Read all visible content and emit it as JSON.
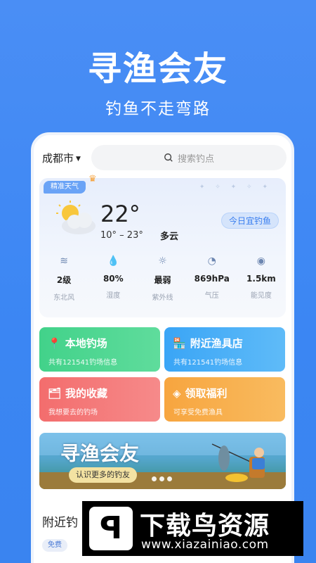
{
  "hero": {
    "title": "寻渔会友",
    "subtitle": "钓鱼不走弯路"
  },
  "header": {
    "city": "成都市",
    "search_placeholder": "搜索钓点"
  },
  "weather": {
    "tag": "精准天气",
    "temperature": "22°",
    "range": "10° – 23°",
    "condition": "多云",
    "fishing_badge": "今日宜钓鱼",
    "stats": [
      {
        "icon": "wind-icon",
        "value": "2级",
        "label": "东北风"
      },
      {
        "icon": "humidity-icon",
        "value": "80%",
        "label": "湿度"
      },
      {
        "icon": "uv-icon",
        "value": "最弱",
        "label": "紫外线"
      },
      {
        "icon": "pressure-icon",
        "value": "869hPa",
        "label": "气压"
      },
      {
        "icon": "visibility-icon",
        "value": "1.5km",
        "label": "能见度"
      }
    ]
  },
  "tiles": [
    {
      "title": "本地钓场",
      "subtitle": "共有121541钓场信息",
      "icon": "location-pin-icon"
    },
    {
      "title": "附近渔具店",
      "subtitle": "共有121541钓场信息",
      "icon": "store-icon"
    },
    {
      "title": "我的收藏",
      "subtitle": "我想要去的钓场",
      "icon": "favorite-folder-icon"
    },
    {
      "title": "领取福利",
      "subtitle": "可享受免费渔具",
      "icon": "gift-diamond-icon"
    }
  ],
  "banner": {
    "title": "寻渔会友",
    "subtitle": "认识更多的钓友"
  },
  "nearby": {
    "title": "附近钓",
    "badge": "免费"
  },
  "watermark": {
    "title": "下载鸟资源",
    "url": "www.xiazainiao.com"
  },
  "colors": {
    "primary": "#3b86f3",
    "green": "#42d28a",
    "blue": "#3aa5f6",
    "red": "#f36d6d",
    "orange": "#f7a53f"
  }
}
